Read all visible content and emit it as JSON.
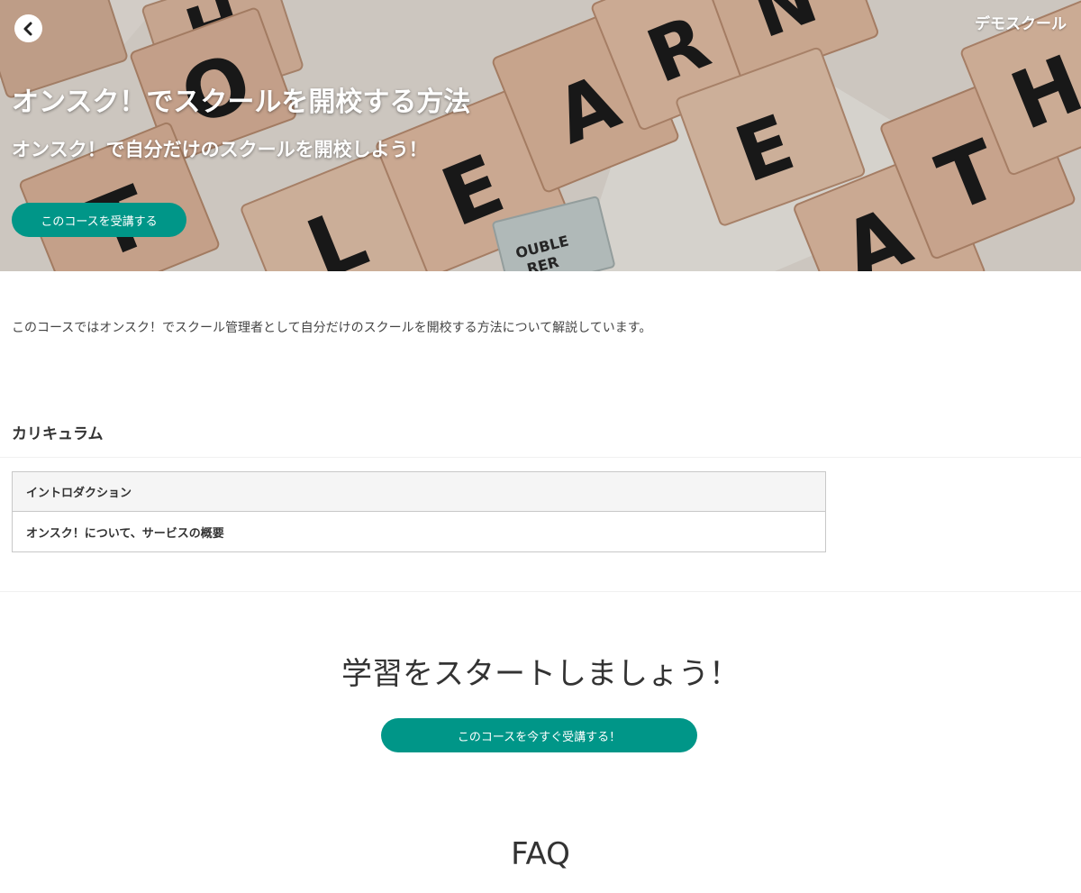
{
  "header": {
    "school_name": "デモスクール",
    "back_icon": "chevron-left-icon"
  },
  "hero": {
    "title": "オンスク！でスクールを開校する方法",
    "subtitle": "オンスク！で自分だけのスクールを開校しよう！",
    "cta_label": "このコースを受講する",
    "tile_letters": [
      "H",
      "O",
      "T",
      "L",
      "E",
      "A",
      "R",
      "N",
      "E",
      "A",
      "T",
      "H",
      "A"
    ],
    "double_word_text": [
      "OUBLE",
      "RER"
    ]
  },
  "course": {
    "description": "このコースではオンスク！でスクール管理者として自分だけのスクールを開校する方法について解説しています。"
  },
  "curriculum": {
    "title": "カリキュラム",
    "sections": [
      {
        "title": "イントロダクション",
        "lessons": [
          "オンスク！について、サービスの概要"
        ]
      }
    ]
  },
  "start": {
    "heading": "学習をスタートしましょう！",
    "cta_label": "このコースを今すぐ受講する！"
  },
  "faq": {
    "heading": "FAQ"
  },
  "colors": {
    "accent": "#009688",
    "text": "#333333",
    "table_border": "#c8c8c8",
    "section_bg": "#f5f5f5"
  }
}
